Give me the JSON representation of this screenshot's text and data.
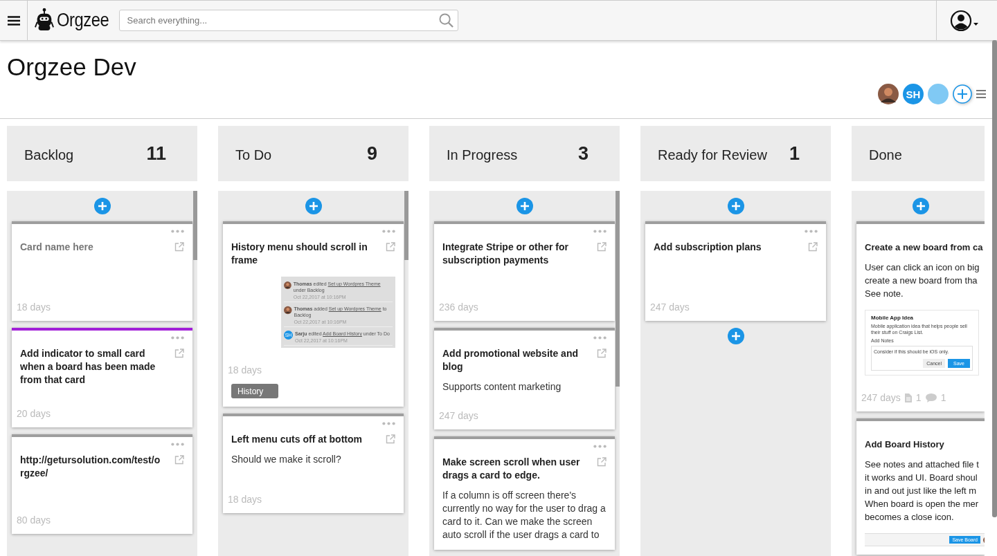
{
  "topbar": {
    "logo": "Orgzee",
    "search": {
      "placeholder": "Search everything..."
    }
  },
  "board": {
    "title": "Orgzee Dev",
    "members": [
      {
        "kind": "photo"
      },
      {
        "kind": "initials",
        "initials": "SH"
      },
      {
        "kind": "blank"
      }
    ]
  },
  "columns": [
    {
      "name": "Backlog",
      "count": "11",
      "add_below": false,
      "cards": [
        {
          "title": "Card name here",
          "placeholder_title": true,
          "color": "#9e9e9e",
          "days": "18 days"
        },
        {
          "title": "Add indicator to small card when a board has been made from that card",
          "placeholder_title": false,
          "color": "#a21fd8",
          "days": "20 days"
        },
        {
          "title": "http://getursolution.com/test/orgzee/",
          "placeholder_title": false,
          "color": "#9e9e9e",
          "days": "80 days"
        }
      ]
    },
    {
      "name": "To Do",
      "count": "9",
      "add_below": false,
      "cards": [
        {
          "title": "History menu should scroll in frame",
          "placeholder_title": false,
          "color": "#9e9e9e",
          "days": "18 days",
          "label": "History",
          "attachment": {
            "kind": "history",
            "entries": [
              {
                "kind": "photo",
                "user": "Thomas",
                "action": "edited",
                "link": "Set up Wordpres Theme",
                "rest": "under Backlog",
                "time": "Oct 22,2017 at 10:16PM"
              },
              {
                "kind": "photo",
                "user": "Thomas",
                "action": "added",
                "link": "Set up Wordpres Theme",
                "rest": "to Backlog",
                "time": "Oct 22,2017 at 10:16PM"
              },
              {
                "kind": "initials",
                "initials": "SH",
                "user": "Sarju",
                "action": "edited",
                "link": "Add Board History",
                "rest": "under To Do",
                "time": "Oct 22,2017 at 10:16PM"
              }
            ]
          }
        },
        {
          "title": "Left menu cuts off at bottom",
          "placeholder_title": false,
          "color": "#9e9e9e",
          "body": "Should we make it scroll?",
          "days": "18 days"
        }
      ]
    },
    {
      "name": "In Progress",
      "count": "3",
      "add_below": false,
      "cards": [
        {
          "title": "Integrate Stripe or other for subscription payments",
          "placeholder_title": false,
          "color": "#9e9e9e",
          "days": "236 days"
        },
        {
          "title": "Add promotional website and blog",
          "placeholder_title": false,
          "color": "#9e9e9e",
          "body": "Supports content marketing",
          "days": "247 days"
        },
        {
          "title": "Make screen scroll when user drags a card to edge.",
          "placeholder_title": false,
          "color": "#9e9e9e",
          "body": "If a column is off screen there's currently no way for the user to drag a card to it. Can we make the screen auto scroll if the user drags a card to"
        }
      ]
    },
    {
      "name": "Ready for Review",
      "count": "1",
      "add_below": true,
      "cards": [
        {
          "title": "Add subscription plans",
          "placeholder_title": false,
          "color": "#9e9e9e",
          "days": "247 days"
        }
      ]
    },
    {
      "name": "Done",
      "add_below": false,
      "cards": [
        {
          "title": "Create a new board from ca",
          "placeholder_title": false,
          "color": "#9e9e9e",
          "lines": [
            "User can click an icon on big",
            "create a new board from tha",
            "See note."
          ],
          "attachment": {
            "kind": "dialog",
            "title": "Mobile App Idea",
            "description": "Mobile application idea that helps people sell their stuff on Craigs List.",
            "notes_label": "Add Notes",
            "notes": "Consider if this should be iOS only.",
            "cancel": "Cancel",
            "save": "Save"
          },
          "days": "247 days",
          "files": "1",
          "comments": "1"
        },
        {
          "title": "Add Board History",
          "placeholder_title": false,
          "color": "#9e9e9e",
          "lines": [
            "See notes and attached file t",
            "it works and UI. Board shoul",
            "in and out just like the left m",
            "When board is open the mer",
            "becomes a close icon."
          ],
          "attachment": {
            "kind": "toolbar",
            "button": "Save Board"
          }
        }
      ]
    }
  ]
}
